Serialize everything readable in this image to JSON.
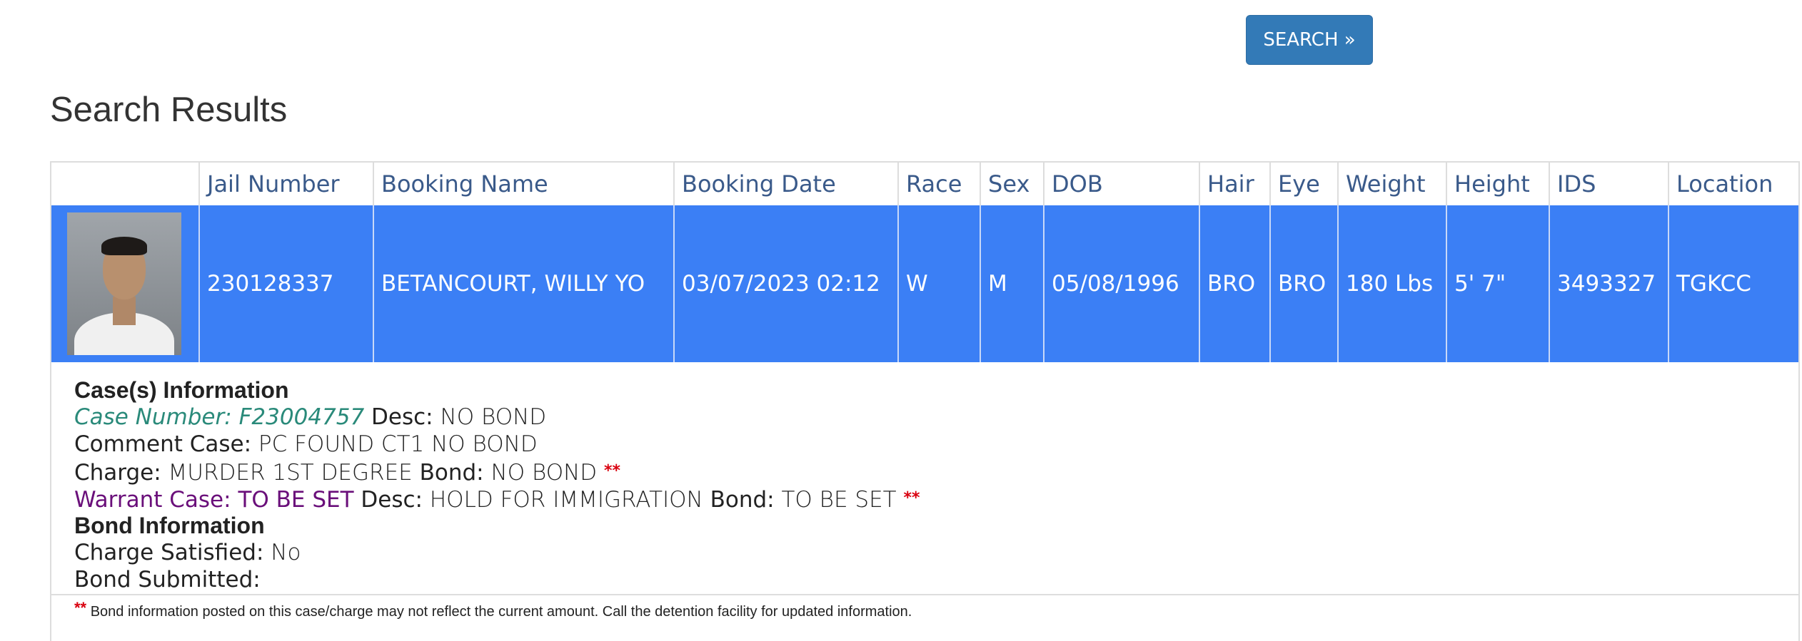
{
  "search_button": {
    "label": "SEARCH »"
  },
  "page_title": "Search Results",
  "columns": [
    "",
    "Jail Number",
    "Booking Name",
    "Booking Date",
    "Race",
    "Sex",
    "DOB",
    "Hair",
    "Eye",
    "Weight",
    "Height",
    "IDS",
    "Location"
  ],
  "row": {
    "jail_number": "230128337",
    "booking_name": "BETANCOURT, WILLY YO",
    "booking_date": "03/07/2023 02:12",
    "race": "W",
    "sex": "M",
    "dob": "05/08/1996",
    "hair": "BRO",
    "eye": "BRO",
    "weight": "180 Lbs",
    "height": "5' 7\"",
    "ids": "3493327",
    "location": "TGKCC",
    "row_color": "#3b7ff5"
  },
  "details": {
    "cases_heading": "Case(s) Information",
    "case_number_label": "Case Number:",
    "case_number": "F23004757",
    "desc_label": "Desc:",
    "desc": "NO BOND",
    "comment_label": "Comment Case:",
    "comment": "PC FOUND CT1 NO BOND",
    "charge_label": "Charge:",
    "charge": "MURDER 1ST DEGREE",
    "bond_label": "Bond:",
    "bond": "NO BOND",
    "stars": "**",
    "warrant_label": "Warrant Case:",
    "warrant": "TO BE SET",
    "warrant_desc_label": "Desc:",
    "warrant_desc": "HOLD FOR IMMIGRATION",
    "warrant_bond_label": "Bond:",
    "warrant_bond": "TO BE SET",
    "bond_heading": "Bond Information",
    "satisfied_label": "Charge Satisfied:",
    "satisfied": "No",
    "submitted_label": "Bond Submitted:",
    "submitted": "",
    "note": "Bond information posted on this case/charge may not reflect the current amount. Call the detention facility for updated information."
  }
}
